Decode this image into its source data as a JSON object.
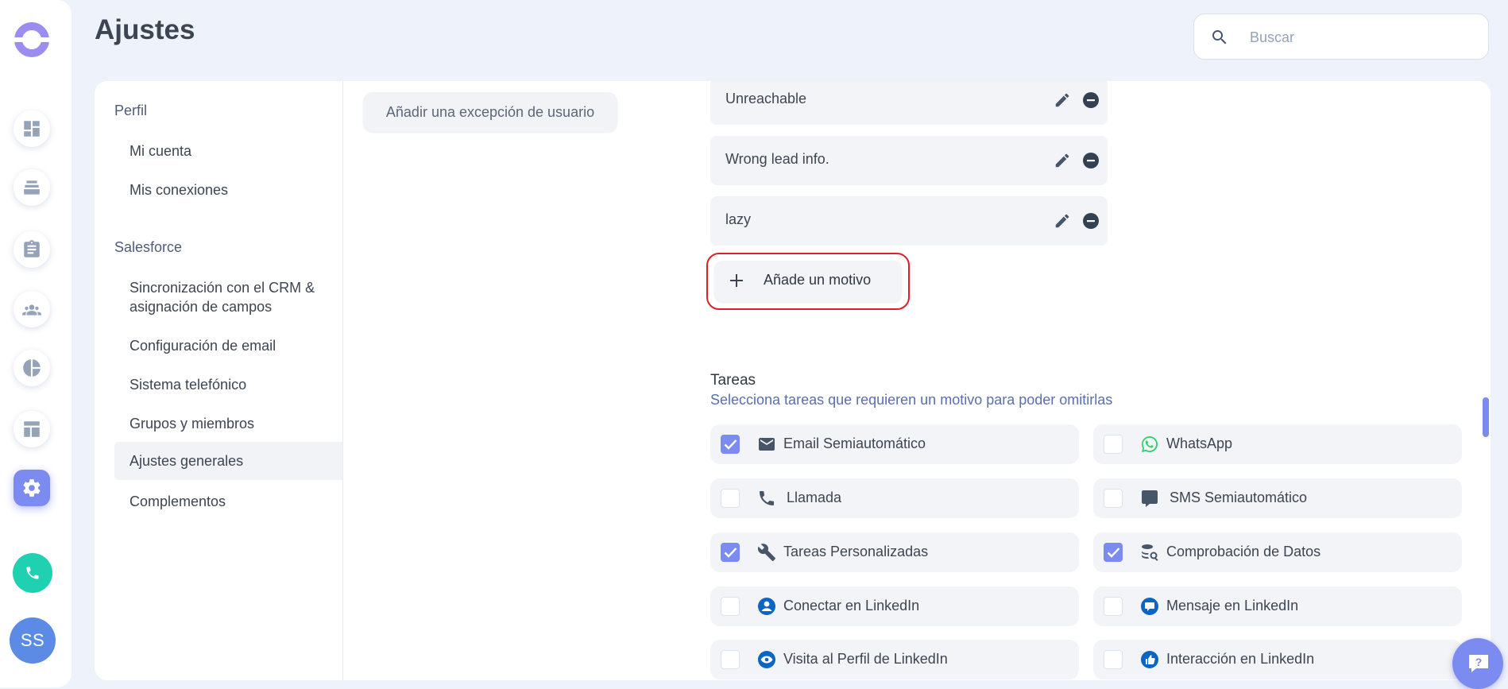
{
  "header": {
    "title": "Ajustes",
    "search_placeholder": "Buscar"
  },
  "rail": {
    "avatar_initials": "SS"
  },
  "sidebar": {
    "sections": [
      {
        "title": "Perfil",
        "items": [
          "Mi cuenta",
          "Mis conexiones"
        ]
      },
      {
        "title": "Salesforce",
        "items": [
          "Sincronización con el CRM & asignación de campos",
          "Configuración de email",
          "Sistema telefónico",
          "Grupos y miembros",
          "Ajustes generales",
          "Complementos"
        ]
      }
    ],
    "active_item": "Ajustes generales"
  },
  "main": {
    "add_exception_label": "Añadir una excepción de usuario",
    "reasons": [
      "Unreachable",
      "Wrong lead info.",
      "lazy"
    ],
    "add_reason_label": "Añade un motivo",
    "tasks": {
      "title": "Tareas",
      "subtitle": "Selecciona tareas que requieren un motivo para poder omitirlas",
      "items": [
        {
          "label": "Email Semiautomático",
          "checked": true,
          "icon": "mail-icon",
          "icon_color": "#475569"
        },
        {
          "label": "WhatsApp",
          "checked": false,
          "icon": "whatsapp-icon",
          "icon_color": "#25d366"
        },
        {
          "label": "Llamada",
          "checked": false,
          "icon": "phone-icon",
          "icon_color": "#475569"
        },
        {
          "label": "SMS Semiautomático",
          "checked": false,
          "icon": "chat-bubble-icon",
          "icon_color": "#475569"
        },
        {
          "label": "Tareas Personalizadas",
          "checked": true,
          "icon": "wrench-icon",
          "icon_color": "#475569"
        },
        {
          "label": "Comprobación de Datos",
          "checked": true,
          "icon": "database-search-icon",
          "icon_color": "#475569"
        },
        {
          "label": "Conectar en LinkedIn",
          "checked": false,
          "icon": "linkedin-person-icon",
          "icon_color": "#0a66c2"
        },
        {
          "label": "Mensaje en LinkedIn",
          "checked": false,
          "icon": "linkedin-message-icon",
          "icon_color": "#0a66c2"
        },
        {
          "label": "Visita al Perfil de LinkedIn",
          "checked": false,
          "icon": "linkedin-eye-icon",
          "icon_color": "#0a66c2"
        },
        {
          "label": "Interacción en LinkedIn",
          "checked": false,
          "icon": "linkedin-thumbs-up-icon",
          "icon_color": "#0a66c2"
        }
      ]
    }
  },
  "colors": {
    "accent": "#7b8bf0",
    "highlight_border": "#e11d2b",
    "call_button": "#1fd1b0",
    "avatar": "#5c8be6"
  }
}
